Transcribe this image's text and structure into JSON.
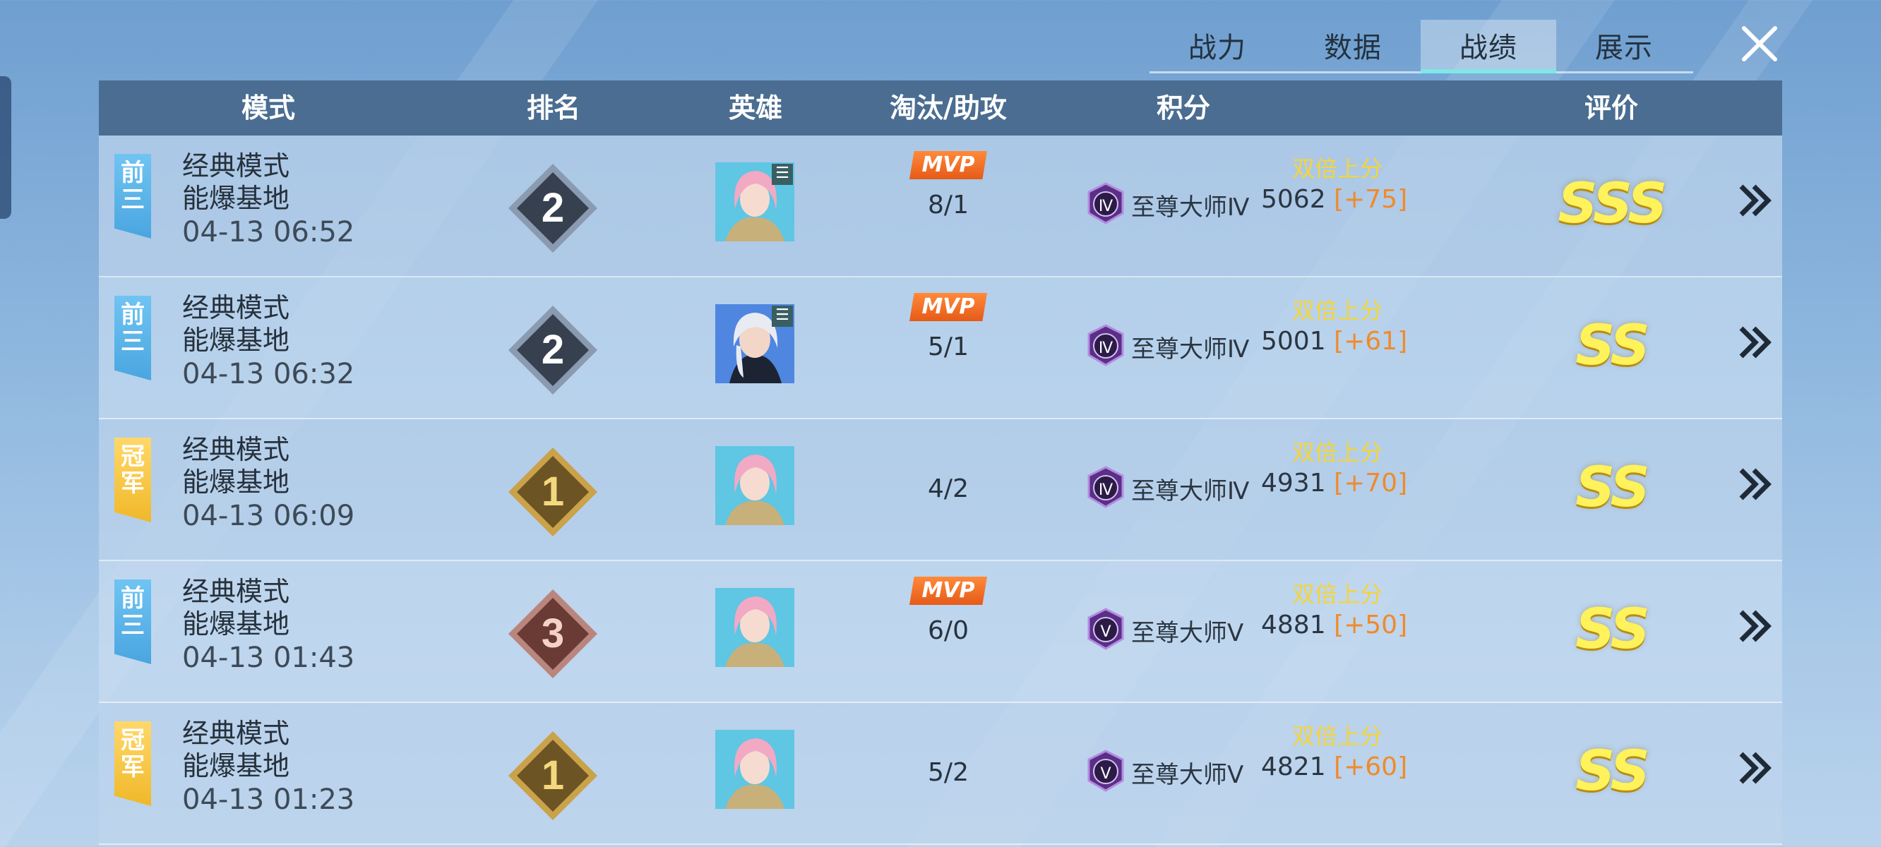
{
  "tabs": [
    {
      "label": "战力",
      "active": false
    },
    {
      "label": "数据",
      "active": false
    },
    {
      "label": "战绩",
      "active": true
    },
    {
      "label": "展示",
      "active": false
    }
  ],
  "close_icon": "close-icon",
  "table": {
    "headers": {
      "mode": "模式",
      "rank": "排名",
      "hero": "英雄",
      "kda": "淘汰/助攻",
      "points": "积分",
      "rating": "评价"
    },
    "rows": [
      {
        "ribbon": "前三",
        "ribbon_color": "#5db5ea",
        "mode": "经典模式",
        "map": "能爆基地",
        "datetime": "04-13 06:52",
        "rank": "2",
        "hero_icon": "hero-pink-hair",
        "hero_tag": "☰",
        "mvp": "MVP",
        "kda": "8/1",
        "double": "双倍上分",
        "tier_roman": "Ⅳ",
        "tier": "至尊大师Ⅳ",
        "score": "5062",
        "delta": "[+75]",
        "grade": "SSS"
      },
      {
        "ribbon": "前三",
        "ribbon_color": "#5db5ea",
        "mode": "经典模式",
        "map": "能爆基地",
        "datetime": "04-13 06:32",
        "rank": "2",
        "hero_icon": "hero-white-hair",
        "hero_tag": "☰",
        "mvp": "MVP",
        "kda": "5/1",
        "double": "双倍上分",
        "tier_roman": "Ⅳ",
        "tier": "至尊大师Ⅳ",
        "score": "5001",
        "delta": "[+61]",
        "grade": "SS"
      },
      {
        "ribbon": "冠军",
        "ribbon_color": "#f5c53a",
        "mode": "经典模式",
        "map": "能爆基地",
        "datetime": "04-13 06:09",
        "rank": "1",
        "hero_icon": "hero-pink-hair",
        "hero_tag": "",
        "mvp": "",
        "kda": "4/2",
        "double": "双倍上分",
        "tier_roman": "Ⅳ",
        "tier": "至尊大师Ⅳ",
        "score": "4931",
        "delta": "[+70]",
        "grade": "SS"
      },
      {
        "ribbon": "前三",
        "ribbon_color": "#5db5ea",
        "mode": "经典模式",
        "map": "能爆基地",
        "datetime": "04-13 01:43",
        "rank": "3",
        "hero_icon": "hero-pink-hair",
        "hero_tag": "",
        "mvp": "MVP",
        "kda": "6/0",
        "double": "双倍上分",
        "tier_roman": "Ⅴ",
        "tier": "至尊大师Ⅴ",
        "score": "4881",
        "delta": "[+50]",
        "grade": "SS"
      },
      {
        "ribbon": "冠军",
        "ribbon_color": "#f5c53a",
        "mode": "经典模式",
        "map": "能爆基地",
        "datetime": "04-13 01:23",
        "rank": "1",
        "hero_icon": "hero-pink-hair",
        "hero_tag": "",
        "mvp": "",
        "kda": "5/2",
        "double": "双倍上分",
        "tier_roman": "Ⅴ",
        "tier": "至尊大师Ⅴ",
        "score": "4821",
        "delta": "[+60]",
        "grade": "SS"
      }
    ]
  }
}
